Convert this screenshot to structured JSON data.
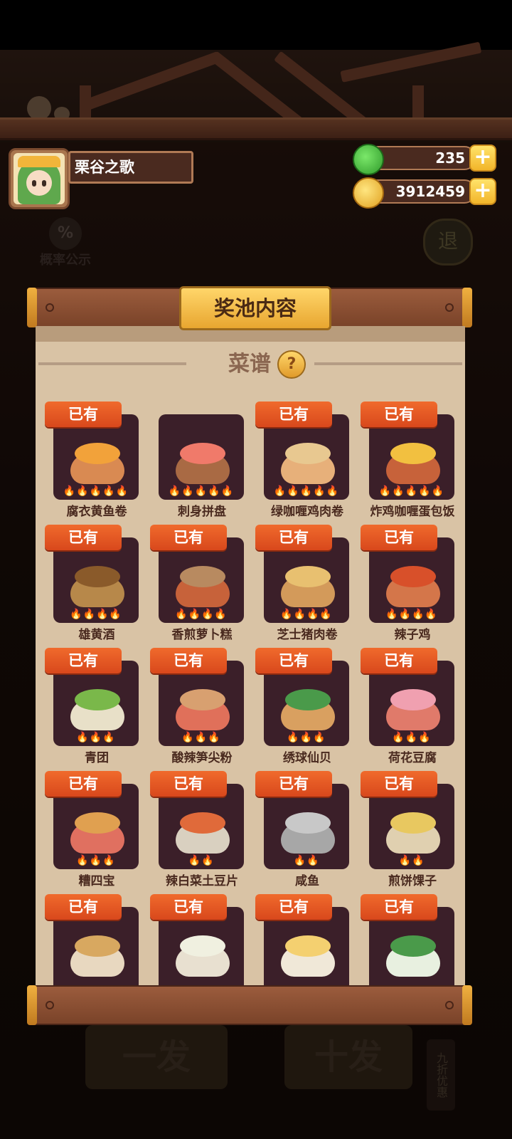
{
  "player": {
    "name": "栗谷之歌"
  },
  "resources": {
    "gems": "235",
    "coins": "3912459"
  },
  "icons": {
    "gem": "green-gem-icon",
    "coin": "gold-coin-icon",
    "plus": "plus-icon",
    "help": "question-icon"
  },
  "background": {
    "probability_label": "概率公示",
    "exit_label": "退",
    "single_draw_label": "一发",
    "ten_draw_label": "十发",
    "discount_label": "九折优惠"
  },
  "panel": {
    "title": "奖池内容",
    "section_title": "菜谱",
    "help_symbol": "?"
  },
  "owned_label": "已有",
  "recipes": [
    {
      "name": "腐衣黄鱼卷",
      "owned": true,
      "rarity": 5
    },
    {
      "name": "刺身拼盘",
      "owned": false,
      "rarity": 5
    },
    {
      "name": "绿咖喱鸡肉卷",
      "owned": true,
      "rarity": 5
    },
    {
      "name": "炸鸡咖喱蛋包饭",
      "owned": true,
      "rarity": 5
    },
    {
      "name": "雄黄酒",
      "owned": true,
      "rarity": 4
    },
    {
      "name": "香煎萝卜糕",
      "owned": true,
      "rarity": 4
    },
    {
      "name": "芝士猪肉卷",
      "owned": true,
      "rarity": 4
    },
    {
      "name": "辣子鸡",
      "owned": true,
      "rarity": 4
    },
    {
      "name": "青团",
      "owned": true,
      "rarity": 3
    },
    {
      "name": "酸辣笋尖粉",
      "owned": true,
      "rarity": 3
    },
    {
      "name": "绣球仙贝",
      "owned": true,
      "rarity": 3
    },
    {
      "name": "荷花豆腐",
      "owned": true,
      "rarity": 3
    },
    {
      "name": "糟四宝",
      "owned": true,
      "rarity": 3
    },
    {
      "name": "辣白菜土豆片",
      "owned": true,
      "rarity": 2
    },
    {
      "name": "咸鱼",
      "owned": true,
      "rarity": 2
    },
    {
      "name": "煎饼馃子",
      "owned": true,
      "rarity": 2
    },
    {
      "name": "",
      "owned": true,
      "rarity": 0
    },
    {
      "name": "",
      "owned": true,
      "rarity": 0
    },
    {
      "name": "",
      "owned": true,
      "rarity": 0
    },
    {
      "name": "",
      "owned": true,
      "rarity": 0
    }
  ],
  "colors": {
    "owned_tag": "#e85a22",
    "card_bg": "#3b1f29",
    "paper": "#d9c3a5",
    "title_plate": "#f2bd48"
  }
}
